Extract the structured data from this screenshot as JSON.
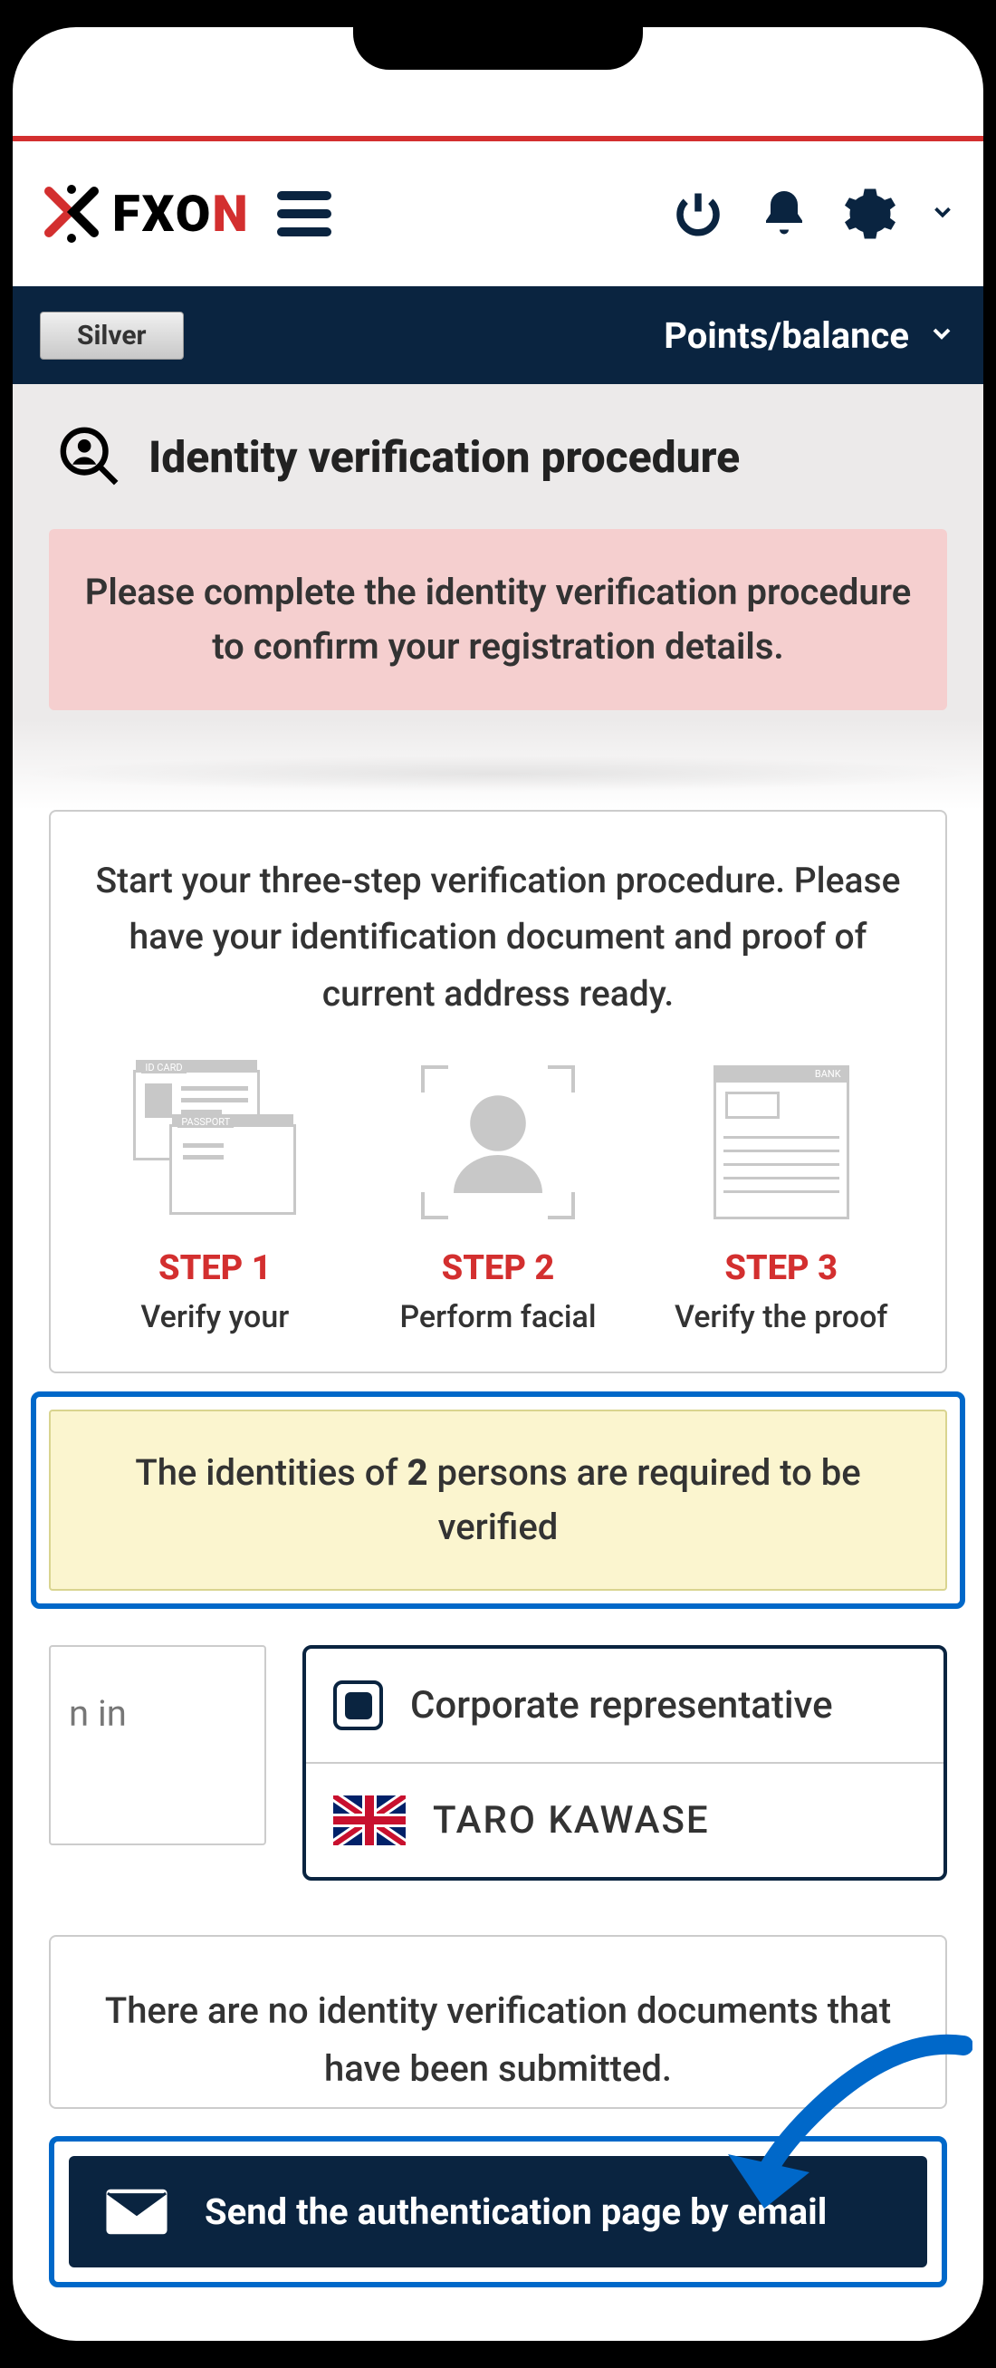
{
  "header": {
    "logo_text_1": "FXO",
    "logo_text_2": "N"
  },
  "balance_bar": {
    "badge": "Silver",
    "label": "Points/balance"
  },
  "page": {
    "title": "Identity verification procedure",
    "alert": "Please complete the identity verification procedure to confirm your registration details."
  },
  "card": {
    "intro": "Start your three-step verification procedure. Please have your identification document and proof of current address ready.",
    "step1_icon_label1": "ID CARD",
    "step1_icon_label2": "PASSPORT",
    "step1_label": "STEP 1",
    "step1_desc": "Verify your",
    "step2_label": "STEP 2",
    "step2_desc": "Perform facial",
    "step3_icon_label": "BANK",
    "step3_label": "STEP 3",
    "step3_desc": "Verify the proof"
  },
  "highlight": {
    "pre": "The identities of ",
    "count": "2",
    "post": " persons are required to be verified"
  },
  "dual": {
    "left_partial": "n in",
    "rep_label": "Corporate representative",
    "person_name": "TARO KAWASE"
  },
  "docs": {
    "text": "There are no identity verification documents that have been submitted."
  },
  "send": {
    "label": "Send the authentication page by email"
  }
}
